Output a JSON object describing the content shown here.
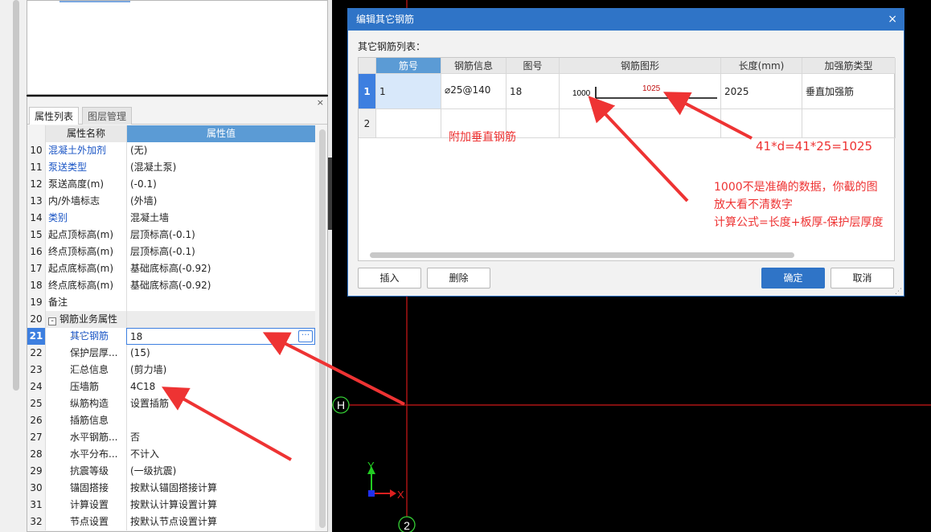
{
  "property_panel": {
    "tabs": [
      {
        "label": "属性列表"
      },
      {
        "label": "图层管理"
      }
    ],
    "headers": {
      "name": "属性名称",
      "value": "属性值"
    },
    "rows": [
      {
        "num": "10",
        "name": "混凝土外加剂",
        "value": "(无)",
        "blue": true
      },
      {
        "num": "11",
        "name": "泵送类型",
        "value": "(混凝土泵)",
        "blue": true
      },
      {
        "num": "12",
        "name": "泵送高度(m)",
        "value": "(-0.1)"
      },
      {
        "num": "13",
        "name": "内/外墙标志",
        "value": "(外墙)"
      },
      {
        "num": "14",
        "name": "类别",
        "value": "混凝土墙",
        "blue": true
      },
      {
        "num": "15",
        "name": "起点顶标高(m)",
        "value": "层顶标高(-0.1)"
      },
      {
        "num": "16",
        "name": "终点顶标高(m)",
        "value": "层顶标高(-0.1)"
      },
      {
        "num": "17",
        "name": "起点底标高(m)",
        "value": "基础底标高(-0.92)"
      },
      {
        "num": "18",
        "name": "终点底标高(m)",
        "value": "基础底标高(-0.92)"
      },
      {
        "num": "19",
        "name": "备注",
        "value": ""
      },
      {
        "num": "20",
        "name": "钢筋业务属性",
        "value": "",
        "group": true,
        "expander": "-"
      },
      {
        "num": "21",
        "name": "其它钢筋",
        "value": "18",
        "selected": true,
        "indent": true
      },
      {
        "num": "22",
        "name": "保护层厚...",
        "value": "(15)",
        "indent": true
      },
      {
        "num": "23",
        "name": "汇总信息",
        "value": "(剪力墙)",
        "indent": true
      },
      {
        "num": "24",
        "name": "压墙筋",
        "value": "4C18",
        "indent": true
      },
      {
        "num": "25",
        "name": "纵筋构造",
        "value": "设置插筋",
        "indent": true
      },
      {
        "num": "26",
        "name": "插筋信息",
        "value": "",
        "indent": true
      },
      {
        "num": "27",
        "name": "水平钢筋...",
        "value": "否",
        "indent": true
      },
      {
        "num": "28",
        "name": "水平分布...",
        "value": "不计入",
        "indent": true
      },
      {
        "num": "29",
        "name": "抗震等级",
        "value": "(一级抗震)",
        "indent": true
      },
      {
        "num": "30",
        "name": "锚固搭接",
        "value": "按默认锚固搭接计算",
        "indent": true
      },
      {
        "num": "31",
        "name": "计算设置",
        "value": "按默认计算设置计算",
        "indent": true
      },
      {
        "num": "32",
        "name": "节点设置",
        "value": "按默认节点设置计算",
        "indent": true
      }
    ],
    "ellipsis": "···"
  },
  "dialog": {
    "title": "编辑其它钢筋",
    "close": "×",
    "list_label": "其它钢筋列表：",
    "columns": [
      "筋号",
      "钢筋信息",
      "图号",
      "钢筋图形",
      "长度(mm)",
      "加强筋类型"
    ],
    "rows": [
      {
        "num": "1",
        "bar_no": "1",
        "info": "⌀25@140",
        "fig": "18",
        "shape_left": "1000",
        "shape_right": "1025",
        "length": "2025",
        "type": "垂直加强筋"
      },
      {
        "num": "2",
        "bar_no": "",
        "info": "",
        "fig": "",
        "shape_left": "",
        "shape_right": "",
        "length": "",
        "type": ""
      }
    ],
    "buttons": {
      "insert": "插入",
      "delete": "删除",
      "ok": "确定",
      "cancel": "取消"
    }
  },
  "canvas": {
    "axis_h": "H",
    "axis_2": "2",
    "ucs_x": "X",
    "ucs_y": "Y"
  },
  "annotations": {
    "vertical_bar": "附加垂直钢筋",
    "formula": "41*d=41*25=1025",
    "note_line1": "1000不是准确的数据，你截的图",
    "note_line2": "放大看不清数字",
    "note_line3": "计算公式=长度+板厚-保护层厚度"
  },
  "colors": {
    "accent": "#2f74c7",
    "annotation": "#ee3333",
    "grid_red": "#d01818"
  }
}
